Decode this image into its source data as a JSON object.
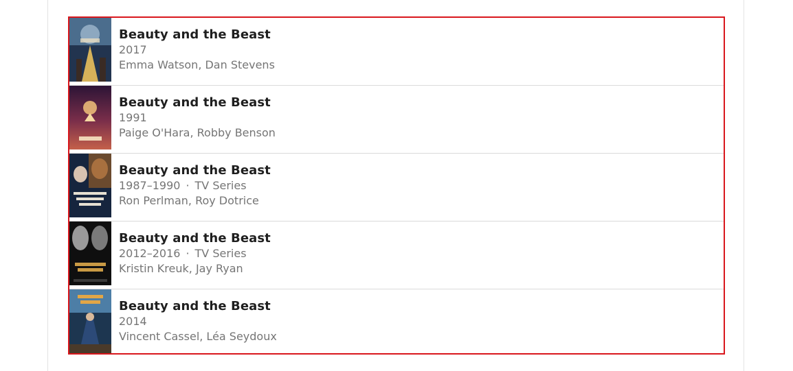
{
  "results": [
    {
      "title": "Beauty and the Beast",
      "year": "2017",
      "type": "",
      "cast": "Emma Watson, Dan Stevens",
      "poster_icon": "movie-poster-icon",
      "poster_colors": [
        "#2a3f5c",
        "#8fb0c9",
        "#c9a04a"
      ]
    },
    {
      "title": "Beauty and the Beast",
      "year": "1991",
      "type": "",
      "cast": "Paige O'Hara, Robby Benson",
      "poster_icon": "movie-poster-icon",
      "poster_colors": [
        "#3b1a3e",
        "#c2504a",
        "#e8b66a"
      ]
    },
    {
      "title": "Beauty and the Beast",
      "year": "1987–1990",
      "type": "TV Series",
      "cast": "Ron Perlman, Roy Dotrice",
      "poster_icon": "tv-poster-icon",
      "poster_colors": [
        "#14233f",
        "#9c5a2e",
        "#d9d2c2"
      ]
    },
    {
      "title": "Beauty and the Beast",
      "year": "2012–2016",
      "type": "TV Series",
      "cast": "Kristin Kreuk, Jay Ryan",
      "poster_icon": "tv-poster-icon",
      "poster_colors": [
        "#0e0e0e",
        "#b8b8b8",
        "#c8953d"
      ]
    },
    {
      "title": "Beauty and the Beast",
      "year": "2014",
      "type": "",
      "cast": "Vincent Cassel, Léa Seydoux",
      "poster_icon": "movie-poster-icon",
      "poster_colors": [
        "#1f3d5a",
        "#5a8ab0",
        "#c48a3a"
      ]
    }
  ],
  "separator": "·",
  "colors": {
    "highlight_border": "#d9161c",
    "title_text": "#1f1f1f",
    "secondary_text": "#757575"
  }
}
